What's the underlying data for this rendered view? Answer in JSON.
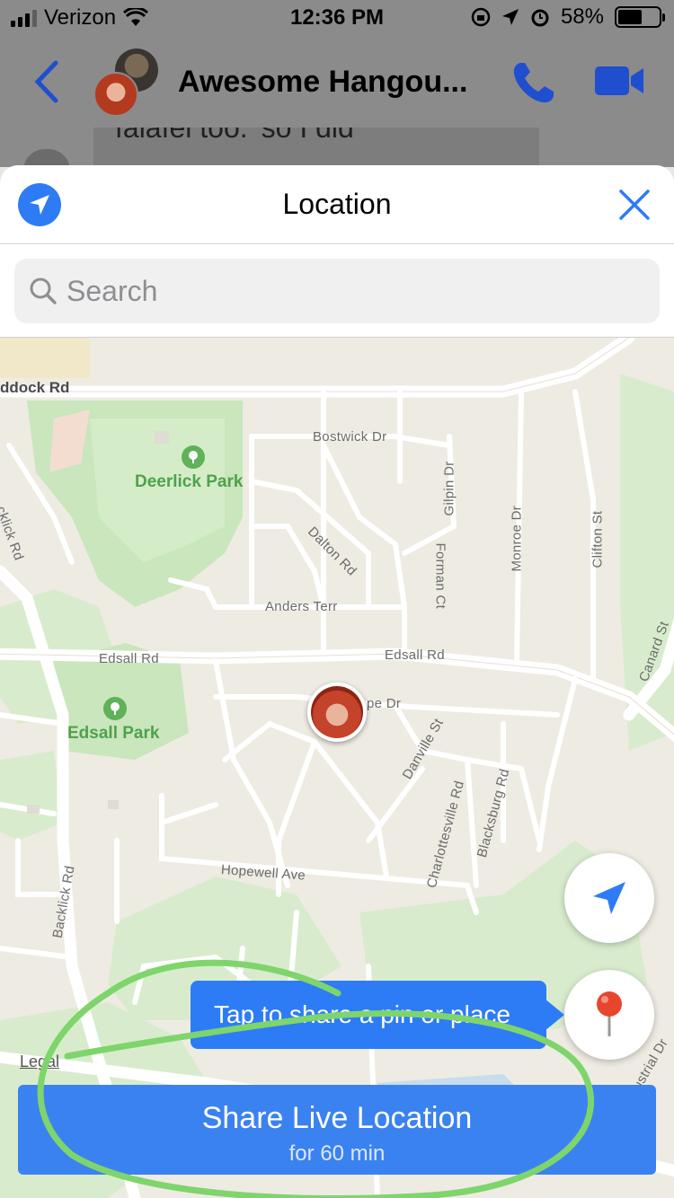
{
  "status_bar": {
    "carrier": "Verizon",
    "time": "12:36 PM",
    "battery": "58%",
    "battery_level": 0.58
  },
  "chat_header": {
    "title": "Awesome Hangou...",
    "peek_text": "falafel too.' so I did"
  },
  "location_sheet": {
    "title": "Location",
    "search_placeholder": "Search"
  },
  "map": {
    "streets": {
      "paddock": "ddock Rd",
      "bostwick": "Bostwick Dr",
      "gilpin": "Gilpin Dr",
      "dalton": "Dalton Rd",
      "forman": "Forman Ct",
      "monroe": "Monroe Dr",
      "clifton": "Clifton St",
      "backlick_top": "cklick Rd",
      "anders": "Anders Terr",
      "edsall_left": "Edsall Rd",
      "edsall_right": "Edsall Rd",
      "canard": "Canard St",
      "hope": "pe Dr",
      "danville": "Danville St",
      "charlottesville": "Charlottesville Rd",
      "blacksburg": "Blacksburg Rd",
      "hopewell": "Hopewell Ave",
      "backlick_bottom": "Backlick Rd",
      "industrial": "ustrial Dr"
    },
    "parks": {
      "deerlick": "Deerlick Park",
      "edsall": "Edsall Park"
    },
    "legal": "Legal",
    "tooltip": "Tap to share a pin or place"
  },
  "share_button": {
    "label": "Share Live Location",
    "sublabel": "for 60 min"
  },
  "colors": {
    "accent": "#2d7cf6",
    "button": "#3b82f1",
    "park": "#c9e6bd",
    "highlight": "#7ed56b"
  }
}
